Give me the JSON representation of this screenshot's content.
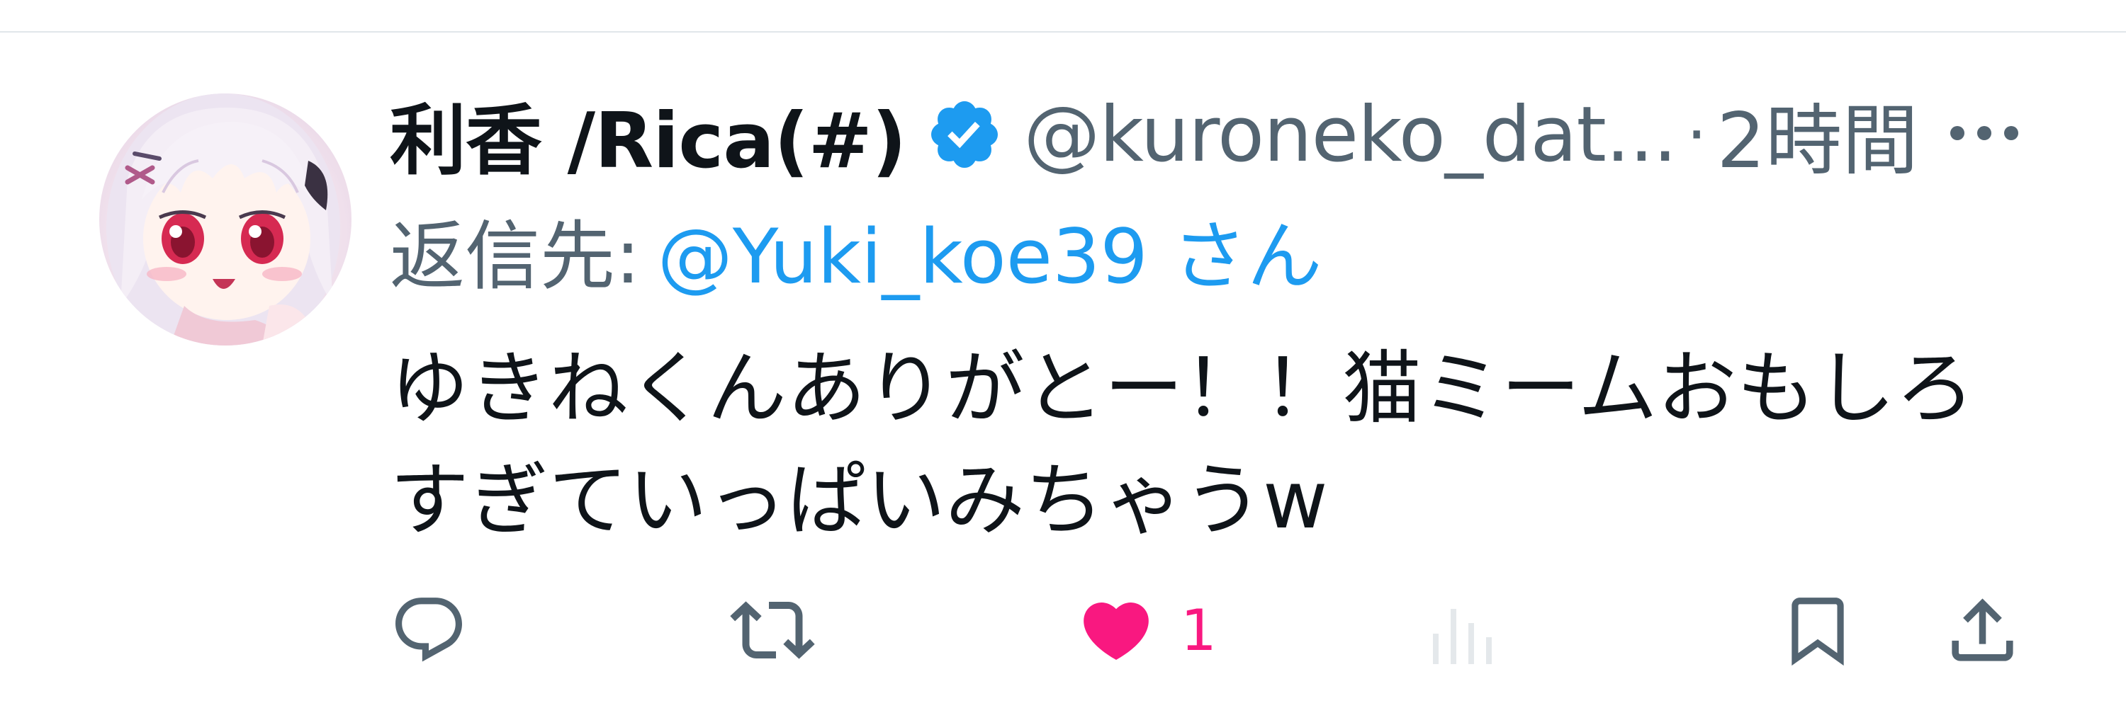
{
  "tweet": {
    "author": {
      "display_name": "利香 /Rica(#)",
      "handle": "@kuroneko_dat...",
      "verified": true
    },
    "separator": "·",
    "time_ago": "2時間",
    "reply_to": {
      "prefix": "返信先:",
      "target": "@Yuki_koe39 さん"
    },
    "text": "ゆきねくんありがとー！！猫ミームおもしろ\nすぎていっぱいみちゃうw",
    "actions": {
      "reply_icon": "reply-icon",
      "retweet_icon": "retweet-icon",
      "like_icon": "heart-filled-icon",
      "like_count": "1",
      "views_icon": "analytics-icon",
      "bookmark_icon": "bookmark-icon",
      "share_icon": "share-icon"
    }
  },
  "colors": {
    "text_primary": "#0f1419",
    "text_secondary": "#536471",
    "link": "#1d9bf0",
    "like": "#f91880",
    "verified": "#1d9bf0",
    "divider": "#e1e6ea"
  }
}
